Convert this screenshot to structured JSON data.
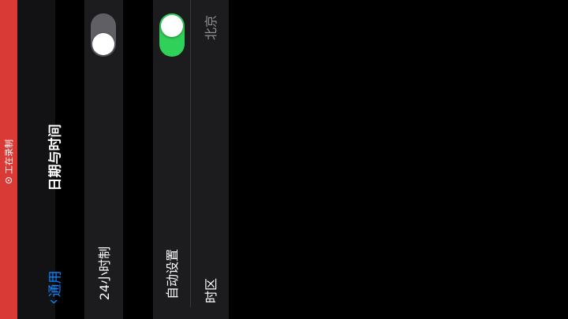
{
  "status_bar": {
    "recording_label": "工在录制"
  },
  "nav": {
    "title": "日期与时间",
    "back_label": "通用"
  },
  "settings": {
    "hour24": {
      "label": "24小时制",
      "enabled": false
    },
    "auto_set": {
      "label": "自动设置",
      "enabled": true
    },
    "timezone": {
      "label": "时区",
      "value": "北京"
    }
  },
  "colors": {
    "recording": "#d93a36",
    "accent": "#0a84ff",
    "toggle_on": "#30d158",
    "toggle_off": "#5f5f64"
  }
}
